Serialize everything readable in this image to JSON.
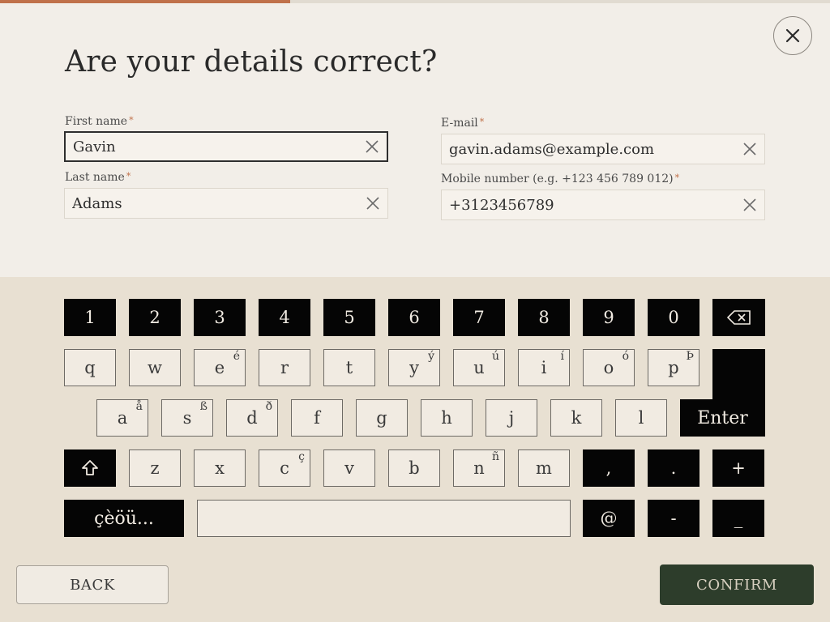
{
  "title": "Are your details correct?",
  "form": {
    "first_name": {
      "label": "First name",
      "required": "*",
      "value": "Gavin"
    },
    "last_name": {
      "label": "Last name",
      "required": "*",
      "value": "Adams"
    },
    "email": {
      "label": "E-mail",
      "required": "*",
      "value": "gavin.adams@example.com"
    },
    "mobile": {
      "label": "Mobile number (e.g. +123 456 789 012)",
      "required": "*",
      "value": "+3123456789"
    }
  },
  "keyboard": {
    "numbers": [
      "1",
      "2",
      "3",
      "4",
      "5",
      "6",
      "7",
      "8",
      "9",
      "0"
    ],
    "row1": [
      {
        "k": "q",
        "alt": ""
      },
      {
        "k": "w",
        "alt": ""
      },
      {
        "k": "e",
        "alt": "é"
      },
      {
        "k": "r",
        "alt": ""
      },
      {
        "k": "t",
        "alt": ""
      },
      {
        "k": "y",
        "alt": "ý"
      },
      {
        "k": "u",
        "alt": "ú"
      },
      {
        "k": "i",
        "alt": "í"
      },
      {
        "k": "o",
        "alt": "ó"
      },
      {
        "k": "p",
        "alt": "Þ"
      }
    ],
    "row2": [
      {
        "k": "a",
        "alt": "å"
      },
      {
        "k": "s",
        "alt": "ß"
      },
      {
        "k": "d",
        "alt": "ð"
      },
      {
        "k": "f",
        "alt": ""
      },
      {
        "k": "g",
        "alt": ""
      },
      {
        "k": "h",
        "alt": ""
      },
      {
        "k": "j",
        "alt": ""
      },
      {
        "k": "k",
        "alt": ""
      },
      {
        "k": "l",
        "alt": ""
      }
    ],
    "row3": [
      {
        "k": "z",
        "alt": ""
      },
      {
        "k": "x",
        "alt": ""
      },
      {
        "k": "c",
        "alt": "ç"
      },
      {
        "k": "v",
        "alt": ""
      },
      {
        "k": "b",
        "alt": ""
      },
      {
        "k": "n",
        "alt": "ñ"
      },
      {
        "k": "m",
        "alt": ""
      }
    ],
    "row3_symbols": [
      ",",
      ".",
      "+"
    ],
    "row4_symbols": [
      "@",
      "-",
      "_"
    ],
    "enter_label": "Enter",
    "special_chars_label": "çèöü...",
    "backspace_icon": "backspace-icon",
    "shift_icon": "shift-arrow-icon"
  },
  "actions": {
    "back": "BACK",
    "confirm": "CONFIRM"
  },
  "progress": {
    "fraction": 0.35
  },
  "colors": {
    "accent": "#c0714a",
    "confirm_bg": "#2d3d2b",
    "key_dark": "#050505",
    "background": "#f2eee8",
    "keyboard_bg": "#e8e0d2"
  }
}
